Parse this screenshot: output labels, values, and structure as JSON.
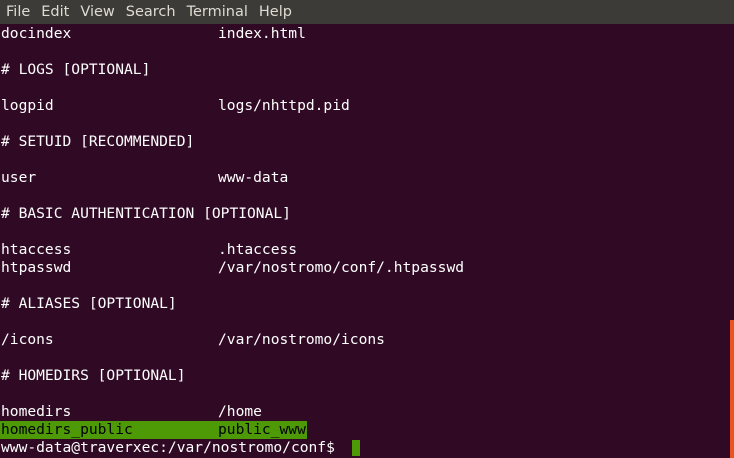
{
  "menubar": {
    "items": [
      "File",
      "Edit",
      "View",
      "Search",
      "Terminal",
      "Help"
    ]
  },
  "terminal": {
    "lines": {
      "docindex_key": "docindex",
      "docindex_val": "index.html",
      "logs_comment": "# LOGS [OPTIONAL]",
      "logpid_key": "logpid",
      "logpid_val": "logs/nhttpd.pid",
      "setuid_comment": "# SETUID [RECOMMENDED]",
      "user_key": "user",
      "user_val": "www-data",
      "auth_comment": "# BASIC AUTHENTICATION [OPTIONAL]",
      "htaccess_key": "htaccess",
      "htaccess_val": ".htaccess",
      "htpasswd_key": "htpasswd",
      "htpasswd_val": "/var/nostromo/conf/.htpasswd",
      "aliases_comment": "# ALIASES [OPTIONAL]",
      "icons_key": "/icons",
      "icons_val": "/var/nostromo/icons",
      "homedirs_comment": "# HOMEDIRS [OPTIONAL]",
      "homedirs_key": "homedirs",
      "homedirs_val": "/home",
      "homedirs_public_key": "homedirs_public",
      "homedirs_public_val": "public_www"
    },
    "prompt": "www-data@traverxec:/var/nostromo/conf$"
  },
  "colors": {
    "background": "#300a24",
    "menubar": "#3c3b37",
    "highlight": "#4e9a06",
    "scrollbar": "#e95420"
  }
}
